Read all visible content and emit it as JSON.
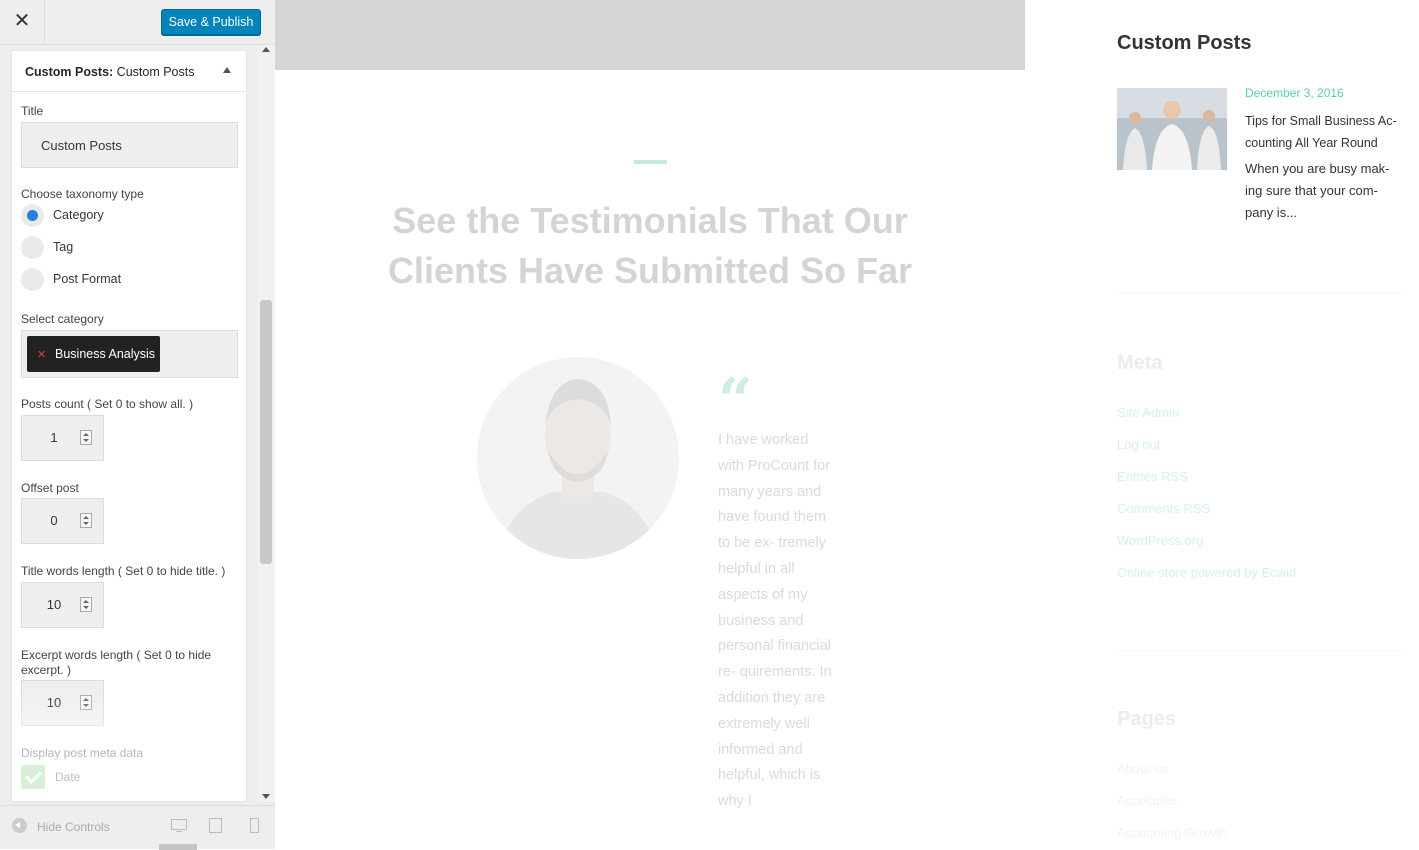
{
  "topbar": {
    "close_icon": "close-icon",
    "publish_label": "Save & Publish",
    "publish_color": "#0085ba"
  },
  "panel": {
    "header_bold": "Custom Posts:",
    "header_rest": " Custom Posts",
    "title_label": "Title",
    "title_value": "Custom Posts",
    "taxonomy_label": "Choose taxonomy type",
    "taxonomy_options": [
      "Category",
      "Tag",
      "Post Format"
    ],
    "taxonomy_selected": "Category",
    "category_label": "Select category",
    "category_tag": "Business Analysis",
    "posts_count_label": "Posts count ( Set 0 to show all. )",
    "posts_count_value": "1",
    "offset_label": "Offset post",
    "offset_value": "0",
    "title_words_label": "Title words length ( Set 0 to hide title. )",
    "title_words_value": "10",
    "excerpt_words_label": "Excerpt words length ( Set 0 to hide excerpt. )",
    "excerpt_words_value": "10",
    "meta_label": "Display post meta data",
    "meta_date_label": "Date",
    "meta_date_checked": true
  },
  "footer": {
    "hide_label": "Hide Controls",
    "devices": [
      "desktop",
      "tablet",
      "mobile"
    ],
    "active_device": "desktop"
  },
  "preview": {
    "heading": "See the Testimonials That Our Clients Have Submitted So Far",
    "quote_mark": "“",
    "quote": "I have worked with ProCount for many years and have found them to be ex- tremely helpful in all aspects of my business and personal financial re- quirements. In addition they are extremely well informed and helpful, which is why I",
    "sidebar_title": "Custom Posts",
    "post_date": "December 3, 2016",
    "post_title": "Tips for Small Business Ac- counting All Year Round",
    "post_excerpt": "When you are busy mak- ing sure that your com- pany is...",
    "meta_heading": "Meta",
    "meta_links": [
      "Site Admin",
      "Log out",
      "Entries RSS",
      "Comments RSS",
      "WordPress.org",
      "Online store powered by Ecwid"
    ],
    "pages_heading": "Pages",
    "pages_links": [
      "About us",
      "Accolades",
      "Accounting Growth"
    ],
    "accent_color": "#57d29c"
  }
}
